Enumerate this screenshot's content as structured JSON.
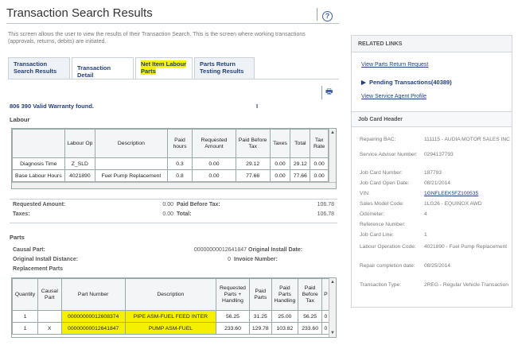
{
  "header": {
    "title": "Transaction Search Results",
    "help_icon": "help-circle-icon",
    "intro": "This screen allows the user to view the results of their Transaction Search. This is the screen where working transactions (approvals, returns, debits) are initiated."
  },
  "tabs": [
    {
      "label": "Transaction Search Results"
    },
    {
      "label": "Transaction Detail"
    },
    {
      "label": "Net Item Labour Parts"
    },
    {
      "label": "Parts Return Testing Results"
    }
  ],
  "print_icon": "print-icon",
  "found_text": "806  390 Valid Warranty found.",
  "found_marker": "I",
  "labour": {
    "section_label": "Labour",
    "columns": [
      "",
      "Labour Op",
      "Description",
      "Paid hours",
      "Requested Amount",
      "Paid Before Tax",
      "Taxes",
      "Total",
      "Tax Rate"
    ],
    "rows": [
      [
        "Diagnosis Time",
        "Z_SLD",
        "",
        "0.3",
        "0.00",
        "29.12",
        "0.00",
        "29.12",
        "0.00"
      ],
      [
        "Base Labour Hours",
        "4021890",
        "Fuel Pump Replacement",
        "0.8",
        "0.00",
        "77.66",
        "0.00",
        "77.66",
        "0.00"
      ]
    ]
  },
  "labour_summary": {
    "requested_label": "Requested Amount:",
    "requested_value": "0.00",
    "paid_before_tax_label": "Paid Before Tax:",
    "paid_before_tax_value": "106.78",
    "taxes_label": "Taxes:",
    "taxes_value": "0.00",
    "total_label": "Total:",
    "total_value": "106.78"
  },
  "parts": {
    "section_label": "Parts",
    "causal_part_label": "Causal Part:",
    "causal_part_value": "00000000012641847",
    "original_install_date_label": "Original Install Date:",
    "original_install_distance_label": "Original Install Distance:",
    "original_install_distance_value": "0",
    "invoice_number_label": "Invoice Number:",
    "replacement_parts_label": "Replacement Parts",
    "columns": [
      "Quantity",
      "Causal Part",
      "Part Number",
      "Description",
      "Requested Parts + Handling",
      "Paid Parts",
      "Paid Parts Handling",
      "Paid Before Tax",
      "P"
    ],
    "rows": [
      [
        "1",
        "",
        "00000000012608374",
        "PIPE ASM-FUEL FEED INTER",
        "56.25",
        "31.25",
        "25.00",
        "56.25",
        "0"
      ],
      [
        "1",
        "X",
        "00000000012641847",
        "PUMP ASM-FUEL",
        "233.60",
        "129.78",
        "103.82",
        "233.60",
        "0"
      ]
    ]
  },
  "related_links": {
    "heading": "RELATED LINKS",
    "view_parts_return": "View Parts Return Request",
    "pending_transactions": "Pending Transactions(40389)",
    "view_service_agent": "View Service Agent Profile"
  },
  "job_card": {
    "heading": "Job Card Header",
    "fields": [
      {
        "label": "Repairing BAC:",
        "value": "111115 - AUDIA MOTOR SALES INC"
      },
      {
        "label": "Service Advisor Number:",
        "value": "0294137793"
      },
      {
        "label": "Job Card Number:",
        "value": "187793"
      },
      {
        "label": "Job Card Open Date:",
        "value": "08/21/2014"
      },
      {
        "label": "VIN:",
        "value": "1GNFLEEK5FZ100535"
      },
      {
        "label": "Sales Model Code:",
        "value": "1LG26  -  EQUINOX AWD"
      },
      {
        "label": "Odometer:",
        "value": "4"
      },
      {
        "label": "Reference Number:",
        "value": ""
      },
      {
        "label": "Job Card Line:",
        "value": "1"
      },
      {
        "label": "Labour Operation Code:",
        "value": "4021890 - Fuel Pump Replacement"
      },
      {
        "label": "Repair completion date:",
        "value": "08/25/2014"
      },
      {
        "label": "Transaction Type:",
        "value": "2REG - Regular Vehicle Transaction"
      }
    ]
  }
}
